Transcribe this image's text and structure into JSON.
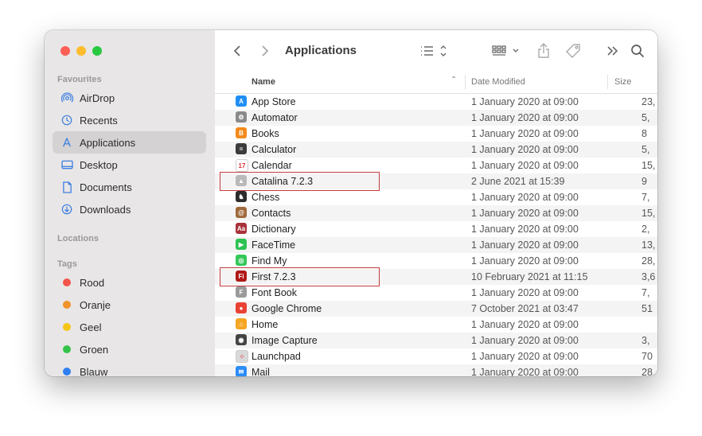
{
  "sidebar": {
    "favourites_heading": "Favourites",
    "favourites": [
      {
        "label": "AirDrop",
        "icon": "airdrop-icon"
      },
      {
        "label": "Recents",
        "icon": "clock-icon"
      },
      {
        "label": "Applications",
        "icon": "applications-icon",
        "selected": true
      },
      {
        "label": "Desktop",
        "icon": "desktop-icon"
      },
      {
        "label": "Documents",
        "icon": "document-icon"
      },
      {
        "label": "Downloads",
        "icon": "download-icon"
      }
    ],
    "locations_heading": "Locations",
    "tags_heading": "Tags",
    "tags": [
      {
        "label": "Rood",
        "color": "#f2534b"
      },
      {
        "label": "Oranje",
        "color": "#f0932b"
      },
      {
        "label": "Geel",
        "color": "#f5c518"
      },
      {
        "label": "Groen",
        "color": "#34c34a"
      },
      {
        "label": "Blauw",
        "color": "#2f7ff0"
      }
    ]
  },
  "toolbar": {
    "title": "Applications",
    "icons": [
      "back-icon",
      "forward-icon",
      "list-view-icon",
      "group-icon",
      "share-icon",
      "tag-icon",
      "more-icon",
      "search-icon"
    ]
  },
  "columns": {
    "name": "Name",
    "date": "Date Modified",
    "size": "Size"
  },
  "files": [
    {
      "name": "App Store",
      "date": "1 January 2020 at 09:00",
      "size": "23,",
      "color": "#1f8ef5",
      "glyph": "A"
    },
    {
      "name": "Automator",
      "date": "1 January 2020 at 09:00",
      "size": "5,",
      "color": "#8a8a8a",
      "glyph": "⚙"
    },
    {
      "name": "Books",
      "date": "1 January 2020 at 09:00",
      "size": "8",
      "color": "#f48a1c",
      "glyph": "B"
    },
    {
      "name": "Calculator",
      "date": "1 January 2020 at 09:00",
      "size": "5,",
      "color": "#3b3b3b",
      "glyph": "="
    },
    {
      "name": "Calendar",
      "date": "1 January 2020 at 09:00",
      "size": "15,",
      "color": "#ffffff",
      "glyph": "17"
    },
    {
      "name": "Catalina 7.2.3",
      "date": "2 June 2021 at 15:39",
      "size": "9",
      "color": "#b9b9b9",
      "glyph": "▲",
      "highlight": true
    },
    {
      "name": "Chess",
      "date": "1 January 2020 at 09:00",
      "size": "7,",
      "color": "#2c2c2c",
      "glyph": "♞"
    },
    {
      "name": "Contacts",
      "date": "1 January 2020 at 09:00",
      "size": "15,",
      "color": "#a06a3b",
      "glyph": "@"
    },
    {
      "name": "Dictionary",
      "date": "1 January 2020 at 09:00",
      "size": "2,",
      "color": "#a8323a",
      "glyph": "Aa"
    },
    {
      "name": "FaceTime",
      "date": "1 January 2020 at 09:00",
      "size": "13,",
      "color": "#2dc253",
      "glyph": "▶"
    },
    {
      "name": "Find My",
      "date": "1 January 2020 at 09:00",
      "size": "28,",
      "color": "#34c759",
      "glyph": "◎"
    },
    {
      "name": "First 7.2.3",
      "date": "10 February 2021 at 11:15",
      "size": "3,6",
      "color": "#b01818",
      "glyph": "Fi",
      "highlight": true
    },
    {
      "name": "Font Book",
      "date": "1 January 2020 at 09:00",
      "size": "7,",
      "color": "#9a9a9a",
      "glyph": "F"
    },
    {
      "name": "Google Chrome",
      "date": "7 October 2021 at 03:47",
      "size": "51",
      "color": "#e94235",
      "glyph": "●"
    },
    {
      "name": "Home",
      "date": "1 January 2020 at 09:00",
      "size": "",
      "color": "#f5a623",
      "glyph": "⌂"
    },
    {
      "name": "Image Capture",
      "date": "1 January 2020 at 09:00",
      "size": "3,",
      "color": "#444444",
      "glyph": "◉"
    },
    {
      "name": "Launchpad",
      "date": "1 January 2020 at 09:00",
      "size": "70",
      "color": "#d9d9d9",
      "glyph": "⁘"
    },
    {
      "name": "Mail",
      "date": "1 January 2020 at 09:00",
      "size": "28,",
      "color": "#2a8cf7",
      "glyph": "✉"
    }
  ]
}
